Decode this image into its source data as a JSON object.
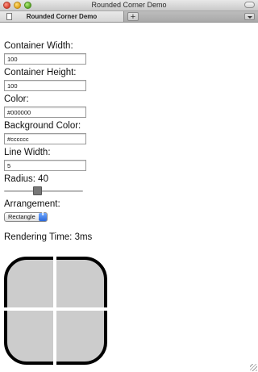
{
  "window": {
    "title": "Rounded Corner Demo"
  },
  "tabs": [
    {
      "label": "Rounded Corner Demo"
    }
  ],
  "tabbar": {
    "add_label": "+"
  },
  "form": {
    "container_width": {
      "label": "Container Width:",
      "value": "100"
    },
    "container_height": {
      "label": "Container Height:",
      "value": "100"
    },
    "color": {
      "label": "Color:",
      "value": "#000000"
    },
    "background_color": {
      "label": "Background Color:",
      "value": "#cccccc"
    },
    "line_width": {
      "label": "Line Width:",
      "value": "5"
    },
    "radius": {
      "label": "Radius:",
      "value": "40",
      "text": "Radius: 40",
      "slider_fraction": 0.42
    },
    "arrangement": {
      "label": "Arrangement:",
      "selected": "Rectangle",
      "arrow": "⬍"
    }
  },
  "rendering_time": {
    "text": "Rendering Time: 3ms"
  },
  "preview": {
    "stroke_color": "#000000",
    "fill_color": "#cccccc",
    "divider_color": "#ffffff"
  }
}
